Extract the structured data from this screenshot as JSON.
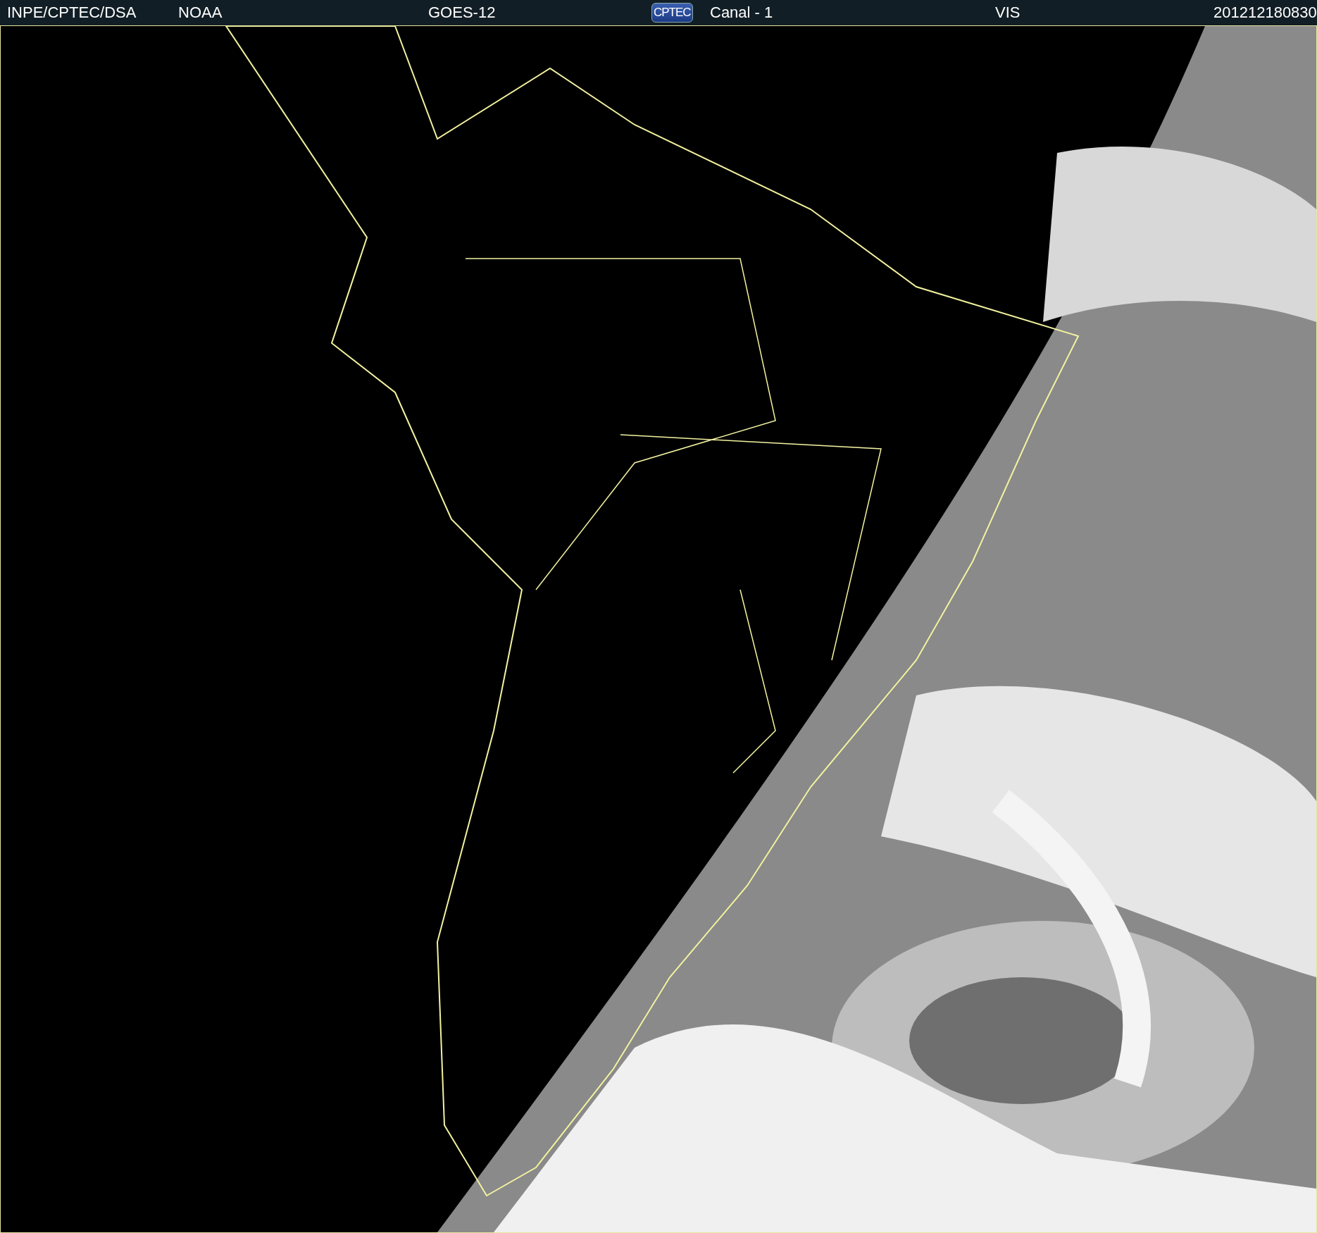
{
  "header": {
    "items": [
      {
        "kind": "text",
        "text": "INPE/CPTEC/DSA"
      },
      {
        "kind": "text",
        "text": "NOAA"
      },
      {
        "kind": "text",
        "text": "GOES-12"
      },
      {
        "kind": "logo",
        "text": "CPTEC"
      },
      {
        "kind": "text",
        "text": "Canal - 1"
      },
      {
        "kind": "text",
        "text": "VIS"
      },
      {
        "kind": "text",
        "text": "201212180830"
      }
    ]
  }
}
